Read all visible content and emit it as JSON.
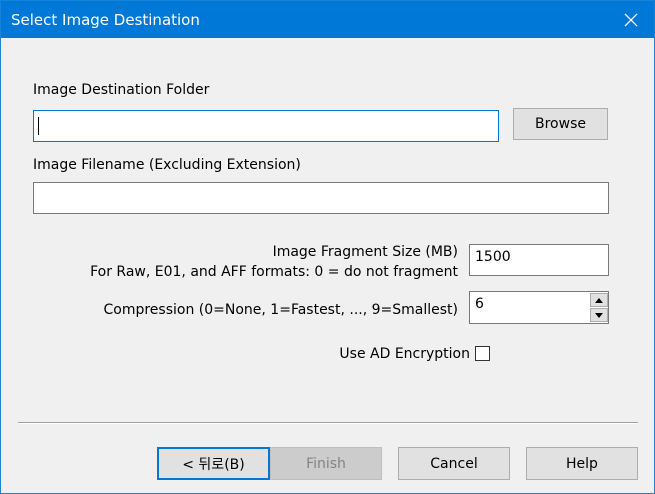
{
  "window": {
    "title": "Select Image Destination"
  },
  "dest_folder": {
    "label": "Image Destination Folder",
    "value": "",
    "browse_label": "Browse"
  },
  "filename": {
    "label": "Image Filename (Excluding Extension)",
    "value": ""
  },
  "fragment": {
    "label_line1": "Image Fragment Size (MB)",
    "label_line2": "For Raw, E01, and AFF formats: 0 = do not fragment",
    "value": "1500"
  },
  "compression": {
    "label": "Compression (0=None, 1=Fastest, ..., 9=Smallest)",
    "value": "6"
  },
  "encryption": {
    "label": "Use AD Encryption",
    "checked": false
  },
  "buttons": {
    "back": "< 뒤로(B)",
    "finish": "Finish",
    "cancel": "Cancel",
    "help": "Help"
  },
  "colors": {
    "titlebar": "#0078d7",
    "focus_border": "#0078d7",
    "background": "#f0f0f0"
  },
  "icons": [
    "close-icon",
    "spin-up-icon",
    "spin-down-icon"
  ]
}
